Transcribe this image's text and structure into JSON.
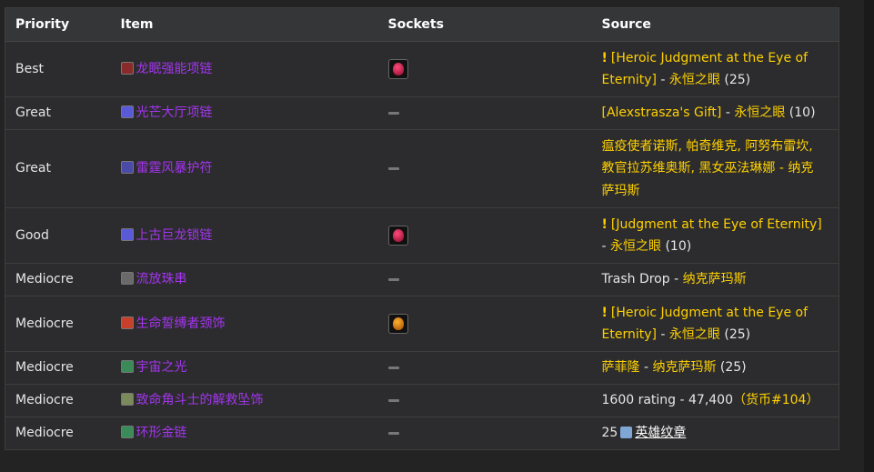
{
  "headers": {
    "priority": "Priority",
    "item": "Item",
    "sockets": "Sockets",
    "source": "Source"
  },
  "rows": [
    {
      "priority": "Best",
      "item": "龙眠强能项链",
      "icon": "necklace-icon",
      "icon_color": "#8a2b2b",
      "socket": "red",
      "source": {
        "quest": "[Heroic Judgment at the Eye of Eternity]",
        "sep": " - ",
        "zone": "永恒之眼",
        "extra": " (25)"
      }
    },
    {
      "priority": "Great",
      "item": "光芒大厅项链",
      "icon": "necklace-icon",
      "icon_color": "#5a5ad8",
      "socket": "none",
      "source": {
        "quest": "[Alexstrasza's Gift]",
        "sep": " - ",
        "zone": "永恒之眼",
        "extra": " (10)"
      }
    },
    {
      "priority": "Great",
      "item": "雷霆风暴护符",
      "icon": "amulet-icon",
      "icon_color": "#4a4aa8",
      "socket": "none",
      "source": {
        "line1": "瘟疫使者诺斯, 帕奇维克, 阿努布雷坎,",
        "line2": "教官拉苏维奥斯, 黑女巫法琳娜 - 纳克",
        "line3": "萨玛斯"
      }
    },
    {
      "priority": "Good",
      "item": "上古巨龙锁链",
      "icon": "chain-icon",
      "icon_color": "#5a5ad8",
      "socket": "red",
      "source": {
        "quest": "[Judgment at the Eye of Eternity]",
        "sep": " - ",
        "zone": "永恒之眼",
        "extra": " (10)"
      }
    },
    {
      "priority": "Mediocre",
      "item": "流放珠串",
      "icon": "beads-icon",
      "icon_color": "#6a6a6a",
      "socket": "none",
      "source": {
        "plain": "Trash Drop",
        "sep": " - ",
        "zone": "纳克萨玛斯"
      }
    },
    {
      "priority": "Mediocre",
      "item": "生命誓缚者颈饰",
      "icon": "pendant-icon",
      "icon_color": "#c8402a",
      "socket": "orange",
      "source": {
        "quest": "[Heroic Judgment at the Eye of Eternity]",
        "sep": " - ",
        "zone": "永恒之眼",
        "extra": " (25)"
      }
    },
    {
      "priority": "Mediocre",
      "item": "宇宙之光",
      "icon": "orb-icon",
      "icon_color": "#3a8a5a",
      "socket": "none",
      "source": {
        "boss": "萨菲隆",
        "sep": " - ",
        "zone": "纳克萨玛斯",
        "extra": " (25)"
      }
    },
    {
      "priority": "Mediocre",
      "item": "致命角斗士的解救坠饰",
      "icon": "pendant-icon",
      "icon_color": "#7a8a5a",
      "socket": "none",
      "source": {
        "plain": "1600 rating - 47,400",
        "currency": "（货币#104）"
      }
    },
    {
      "priority": "Mediocre",
      "item": "环形金链",
      "icon": "chain-icon",
      "icon_color": "#3a8a5a",
      "socket": "none",
      "source": {
        "plain": "25",
        "badge_label": "英雄纹章"
      }
    }
  ]
}
